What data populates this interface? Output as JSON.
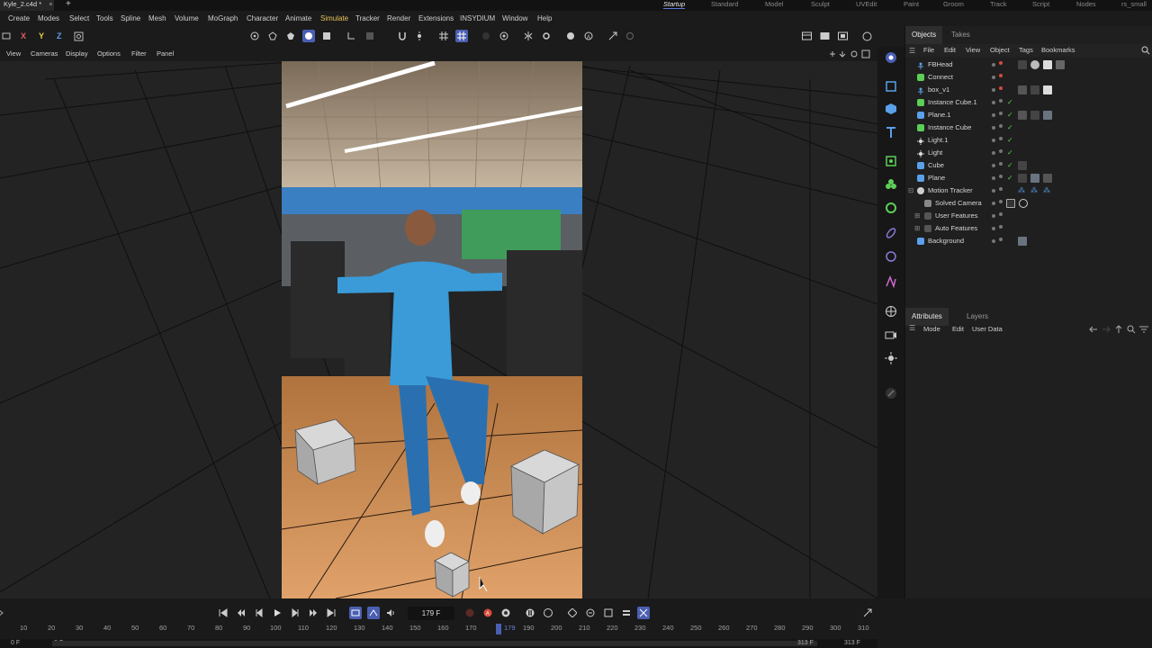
{
  "document": {
    "tab_title": "Kyle_2.c4d *",
    "close_glyph": "×",
    "new_tab_glyph": "+"
  },
  "layouts": [
    "Startup",
    "Standard",
    "Model",
    "Sculpt",
    "UVEdit",
    "Paint",
    "Groom",
    "Track",
    "Script",
    "Nodes",
    "rs_small"
  ],
  "menu": {
    "items": [
      "Create",
      "Modes",
      "Select",
      "Tools",
      "Spline",
      "Mesh",
      "Volume",
      "MoGraph",
      "Character",
      "Animate",
      "Simulate",
      "Tracker",
      "Render",
      "Extensions",
      "INSYDIUM",
      "Window",
      "Help"
    ],
    "highlighted": "Simulate"
  },
  "axes": {
    "x": "X",
    "y": "Y",
    "z": "Z"
  },
  "viewport_menu": [
    "View",
    "Cameras",
    "Display",
    "Options",
    "Filter",
    "Panel"
  ],
  "objects_panel": {
    "tabs": [
      "Objects",
      "Takes"
    ],
    "menu": [
      "File",
      "Edit",
      "View",
      "Object",
      "Tags",
      "Bookmarks"
    ],
    "objects": [
      {
        "name": "FBHead",
        "check": ""
      },
      {
        "name": "Connect",
        "check": ""
      },
      {
        "name": "box_v1",
        "check": ""
      },
      {
        "name": "Instance Cube.1",
        "check": "✓"
      },
      {
        "name": "Plane.1",
        "check": "✓"
      },
      {
        "name": "Instance Cube",
        "check": "✓"
      },
      {
        "name": "Light.1",
        "check": "✓"
      },
      {
        "name": "Light",
        "check": "✓"
      },
      {
        "name": "Cube",
        "check": "✓"
      },
      {
        "name": "Plane",
        "check": "✓"
      },
      {
        "name": "Motion Tracker",
        "check": ""
      },
      {
        "name": "Solved Camera",
        "check": ""
      },
      {
        "name": "User Features",
        "check": ""
      },
      {
        "name": "Auto Features",
        "check": ""
      },
      {
        "name": "Background",
        "check": ""
      }
    ]
  },
  "attributes_panel": {
    "tabs": [
      "Attributes",
      "Layers"
    ],
    "menu": [
      "Mode",
      "Edit",
      "User Data"
    ]
  },
  "timeline": {
    "current_frame": "179 F",
    "ruler_ticks": [
      "10",
      "20",
      "30",
      "40",
      "50",
      "60",
      "70",
      "80",
      "90",
      "100",
      "110",
      "120",
      "130",
      "140",
      "150",
      "160",
      "170",
      "179",
      "190",
      "200",
      "210",
      "220",
      "230",
      "240",
      "250",
      "260",
      "270",
      "280",
      "290",
      "300",
      "310"
    ],
    "range_start_a": "0 F",
    "range_start_b": "0 F",
    "range_end_a": "313 F",
    "range_end_b": "313 F"
  },
  "colors": {
    "accent": "#4a5fb2",
    "menu_highlight": "#e7c35a",
    "check_green": "#5ccf56",
    "record_red": "#d94a3a",
    "shirt_blue": "#3a9bd8",
    "floor_wood": "#c98a4e"
  }
}
